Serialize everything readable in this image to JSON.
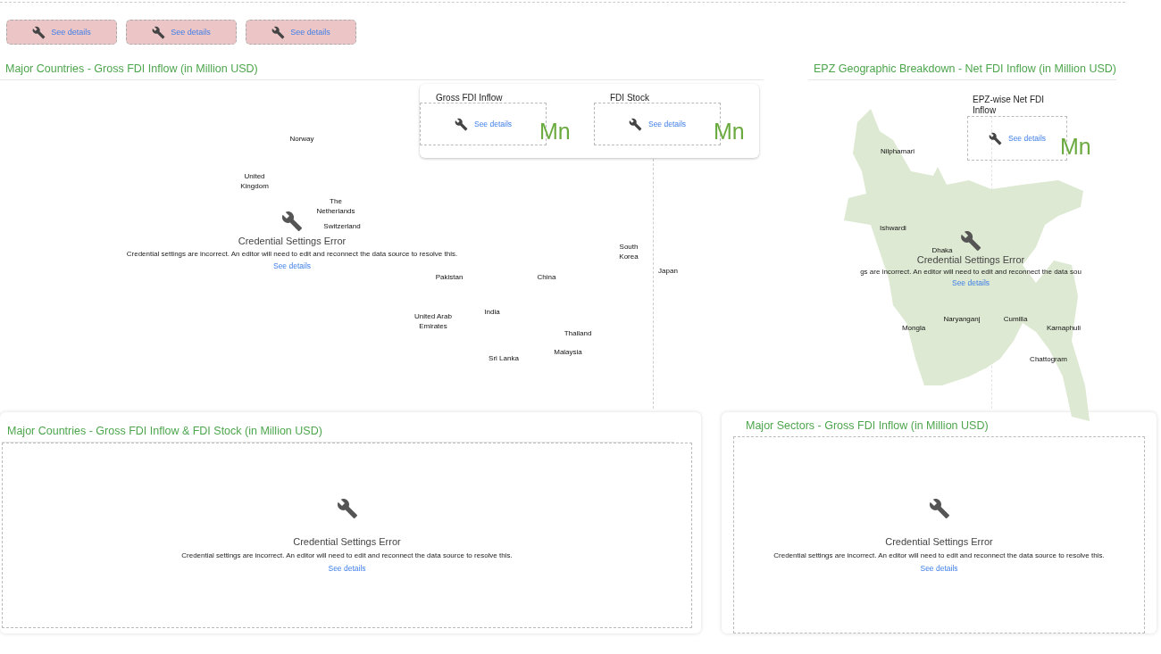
{
  "toolbar_buttons": [
    {
      "label": "See details"
    },
    {
      "label": "See details"
    },
    {
      "label": "See details"
    }
  ],
  "countries_panel": {
    "title": "Major Countries - Gross FDI Inflow (in Million USD)",
    "kpi_tiles": [
      {
        "title": "Gross FDI Inflow",
        "link": "See details",
        "unit": "Mn"
      },
      {
        "title": "FDI Stock",
        "link": "See details",
        "unit": "Mn"
      }
    ],
    "map_labels": [
      "Norway",
      "United Kingdom",
      "The Netherlands",
      "Switzerland",
      "Pakistan",
      "China",
      "South Korea",
      "Japan",
      "India",
      "United Arab Emirates",
      "Thailand",
      "Malaysia",
      "Sri Lanka"
    ],
    "error": {
      "title": "Credential Settings Error",
      "message": "Credential settings are incorrect. An editor will need to edit and reconnect the data source to resolve this.",
      "link": "See details"
    }
  },
  "epz_panel": {
    "title": "EPZ Geographic Breakdown - Net FDI Inflow  (in Million USD)",
    "kpi_tile": {
      "title": "EPZ-wise Net FDI Inflow",
      "link": "See details",
      "unit": "Mn"
    },
    "map_labels": [
      "Nilphamari",
      "Ishwardi",
      "Dhaka",
      "Naryanganj",
      "Cumilla",
      "Mongla",
      "Karnaphuli",
      "Chattogram"
    ],
    "error": {
      "title": "Credential Settings Error",
      "message": "gs are incorrect. An editor will need to edit and reconnect the data sou",
      "link": "See details"
    }
  },
  "bottom_panels": [
    {
      "title": "Major Countries - Gross FDI Inflow & FDI Stock (in Million USD)",
      "error": {
        "title": "Credential Settings Error",
        "message": "Credential settings are incorrect. An editor will need to edit and reconnect the data source to resolve this.",
        "link": "See details"
      }
    },
    {
      "title": "Major Sectors - Gross FDI Inflow  (in Million USD)",
      "error": {
        "title": "Credential Settings Error",
        "message": "Credential settings are incorrect. An editor will need to edit and reconnect the data source to resolve this.",
        "link": "See details"
      }
    }
  ]
}
